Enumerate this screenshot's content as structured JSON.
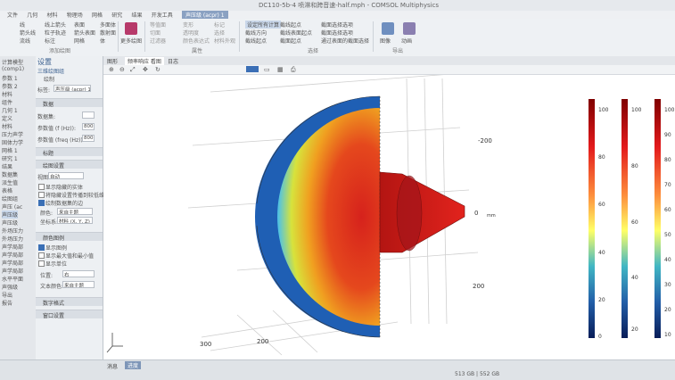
{
  "window": {
    "title": "DC110-5b-4 喷淋和跨音速-half.mph - COMSOL Multiphysics"
  },
  "menu": {
    "items": [
      "文件",
      "几何",
      "材料",
      "物理场",
      "网格",
      "研究",
      "结果",
      "开发工具"
    ],
    "context_tab": "声压级 (acpr) 1"
  },
  "ribbon": {
    "groups": [
      "添加绘图",
      "属性",
      "选择",
      "导出"
    ],
    "items_col1": [
      "线",
      "箭头线",
      "流线"
    ],
    "items_col2": [
      "线上箭头",
      "粒子轨迹",
      "标注"
    ],
    "items_col3": [
      "表面",
      "箭头表面",
      "网格"
    ],
    "items_col4": [
      "多面体",
      "散射面",
      "体"
    ],
    "add_plot": "更多绘图",
    "props": [
      "等值面",
      "切面",
      "过滤器",
      "变形",
      "透明度",
      "颜色表达式",
      "标记",
      "选择",
      "材料外观",
      "材料外观"
    ],
    "select": [
      "设定所有计算",
      "截线方向",
      "截线起点",
      "截面起点"
    ],
    "select2": [
      "截线起点",
      "截线表面起点",
      "截面起点"
    ],
    "select3": [
      "截面选择选项",
      "截面选择选项",
      "通过表面的截面选择"
    ],
    "export_items": [
      "图像",
      "动画"
    ]
  },
  "tree": {
    "items": [
      "计算模型",
      "(comp1)",
      "参数 1",
      "参数 2",
      "材料",
      "组件",
      "几何 1",
      "定义",
      "材料",
      "压力声学",
      "固体力学",
      "网格 1",
      "研究 1",
      "结果",
      "数据集",
      "派生值",
      "表格",
      "绘图组",
      "声压 (ac",
      "声压级",
      "声压级",
      "外场压力",
      "外场压力",
      "声学局部",
      "声学局部",
      "声学局部",
      "声学局部",
      "水平平面",
      "声强级",
      "导出",
      "报告"
    ]
  },
  "settings": {
    "header": "设置",
    "subheader": "三维绘图组",
    "draw_label": "绘制",
    "label_field_label": "标签:",
    "label_field_value": "声压级 (acpr) 1",
    "sections": [
      "数据",
      "标题",
      "绘图设置",
      "颜色图例",
      "数字格式",
      "窗口设置"
    ],
    "dataset_label": "数据集:",
    "param_f_label": "参数值 (f (Hz)):",
    "param_f_value": "800",
    "param_freq_label": "参数值 (freq (Hz)):",
    "param_freq_value": "800",
    "view_label": "视图:",
    "view_value": "自动",
    "show_hidden": "显示隐藏的实体",
    "propagate": "将隐藏设置传播到较低维度",
    "plot_dataset_edges": "绘制数据集的边",
    "color_label": "颜色:",
    "color_value": "来自主题",
    "frame_label": "坐标系:",
    "frame_value": "材料 (X, Y, Z)",
    "show_legend": "显示图例",
    "show_maxmin": "显示最大值和最小值",
    "show_units": "显示单位",
    "position_label": "位置:",
    "position_value": "右",
    "text_color_label": "文本颜色:",
    "text_color_value": "来自主题"
  },
  "graphics": {
    "tabs": [
      "图形",
      "频率响应 看图",
      "日志"
    ],
    "axis_labels": [
      "-200",
      "0",
      "mm",
      "200",
      "300",
      "200"
    ],
    "colorbars": [
      {
        "ticks": [
          "100",
          "80",
          "60",
          "40",
          "20",
          "0"
        ]
      },
      {
        "ticks": [
          "100",
          "80",
          "60",
          "40",
          "20"
        ]
      },
      {
        "ticks": [
          "100",
          "90",
          "80",
          "70",
          "60",
          "50",
          "40",
          "30",
          "20",
          "10"
        ]
      }
    ]
  },
  "status": {
    "tabs": [
      "消息",
      "进度"
    ],
    "memory": "513 GB | 552 GB"
  }
}
